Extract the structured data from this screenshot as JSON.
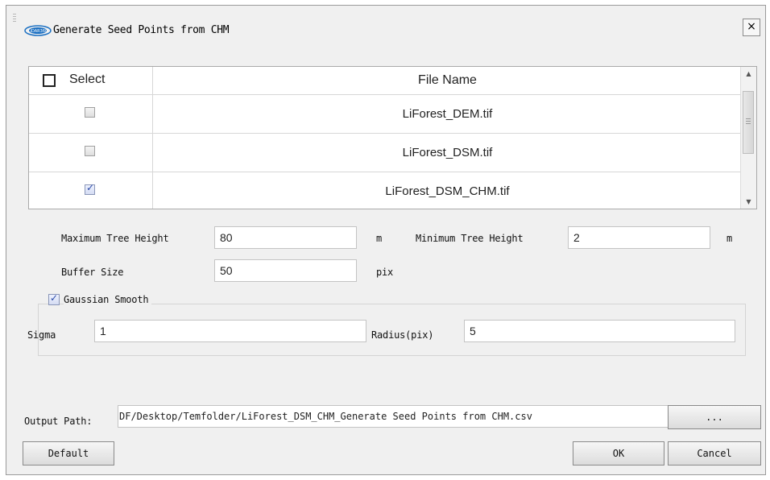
{
  "dialog": {
    "title": "Generate Seed Points from CHM",
    "logo_text": "LiDAR360",
    "close_label": "×"
  },
  "table": {
    "header_select": "Select",
    "header_file": "File Name",
    "rows": [
      {
        "file": "LiForest_DEM.tif",
        "checked": false
      },
      {
        "file": "LiForest_DSM.tif",
        "checked": false
      },
      {
        "file": "LiForest_DSM_CHM.tif",
        "checked": true
      }
    ],
    "scroll_up": "▲",
    "scroll_down": "▼"
  },
  "params": {
    "max_height_label": "Maximum Tree Height",
    "max_height_value": "80",
    "max_height_unit": "m",
    "min_height_label": "Minimum Tree Height",
    "min_height_value": "2",
    "min_height_unit": "m",
    "buffer_label": "Buffer Size",
    "buffer_value": "50",
    "buffer_unit": "pix"
  },
  "gaussian": {
    "label": "Gaussian Smooth",
    "checked": true,
    "tick": "✓",
    "sigma_label": "Sigma",
    "sigma_value": "1",
    "radius_label": "Radius(pix)",
    "radius_value": "5"
  },
  "output": {
    "label": "Output Path:",
    "value": "DF/Desktop/Temfolder/LiForest_DSM_CHM_Generate Seed Points from CHM.csv",
    "browse_label": "..."
  },
  "buttons": {
    "default": "Default",
    "ok": "OK",
    "cancel": "Cancel"
  },
  "colors": {
    "dialog_bg": "#f0f0f0",
    "check_accent": "#2b4aa8",
    "logo_blue": "#1a6fc2"
  }
}
